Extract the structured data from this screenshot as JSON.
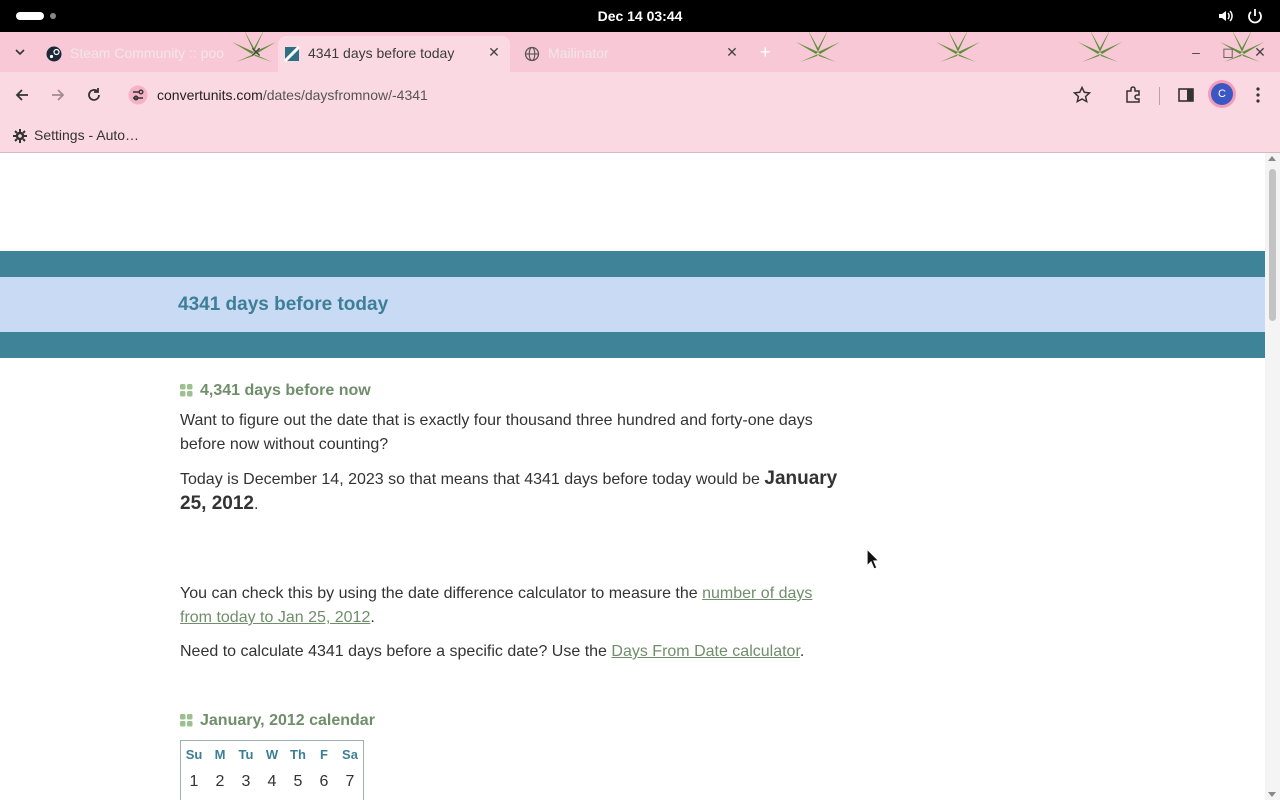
{
  "system_bar": {
    "clock": "Dec 14  03:44"
  },
  "browser": {
    "tabs": [
      {
        "title": "Steam Community :: poo",
        "favicon": "steam-icon",
        "active": false
      },
      {
        "title": "4341 days before today",
        "favicon": "convertunits-icon",
        "active": true
      },
      {
        "title": "Mailinator",
        "favicon": "globe-icon",
        "active": false
      }
    ],
    "url_domain": "convertunits.com",
    "url_path": "/dates/daysfromnow/-4341",
    "profile_initial": "C",
    "bookmarks": [
      {
        "label": "Settings - Auto…",
        "icon": "gear-icon"
      }
    ]
  },
  "page": {
    "title": "4341 days before today",
    "section1_heading": "4,341 days before now",
    "intro": "Want to figure out the date that is exactly four thousand three hundred and forty-one days before now without counting?",
    "today_prefix": "Today is December 14, 2023 so that means that 4341 days before today would be ",
    "result_date": "January 25, 2012",
    "period": ".",
    "check_prefix": "You can check this by using the date difference calculator to measure the ",
    "check_link": "number of days from today to Jan 25, 2012",
    "need_prefix": "Need to calculate 4341 days before a specific date? Use the ",
    "need_link": "Days From Date calculator",
    "calendar_heading": "January, 2012 calendar",
    "calendar": {
      "weekdays": [
        "Su",
        "M",
        "Tu",
        "W",
        "Th",
        "F",
        "Sa"
      ],
      "first_week": [
        "1",
        "2",
        "3",
        "4",
        "5",
        "6",
        "7"
      ]
    }
  },
  "colors": {
    "chrome_pink": "#f8c8d6",
    "band_teal": "#3f8399",
    "title_band": "#c9daf5",
    "heading_green": "#6f8e6a"
  }
}
